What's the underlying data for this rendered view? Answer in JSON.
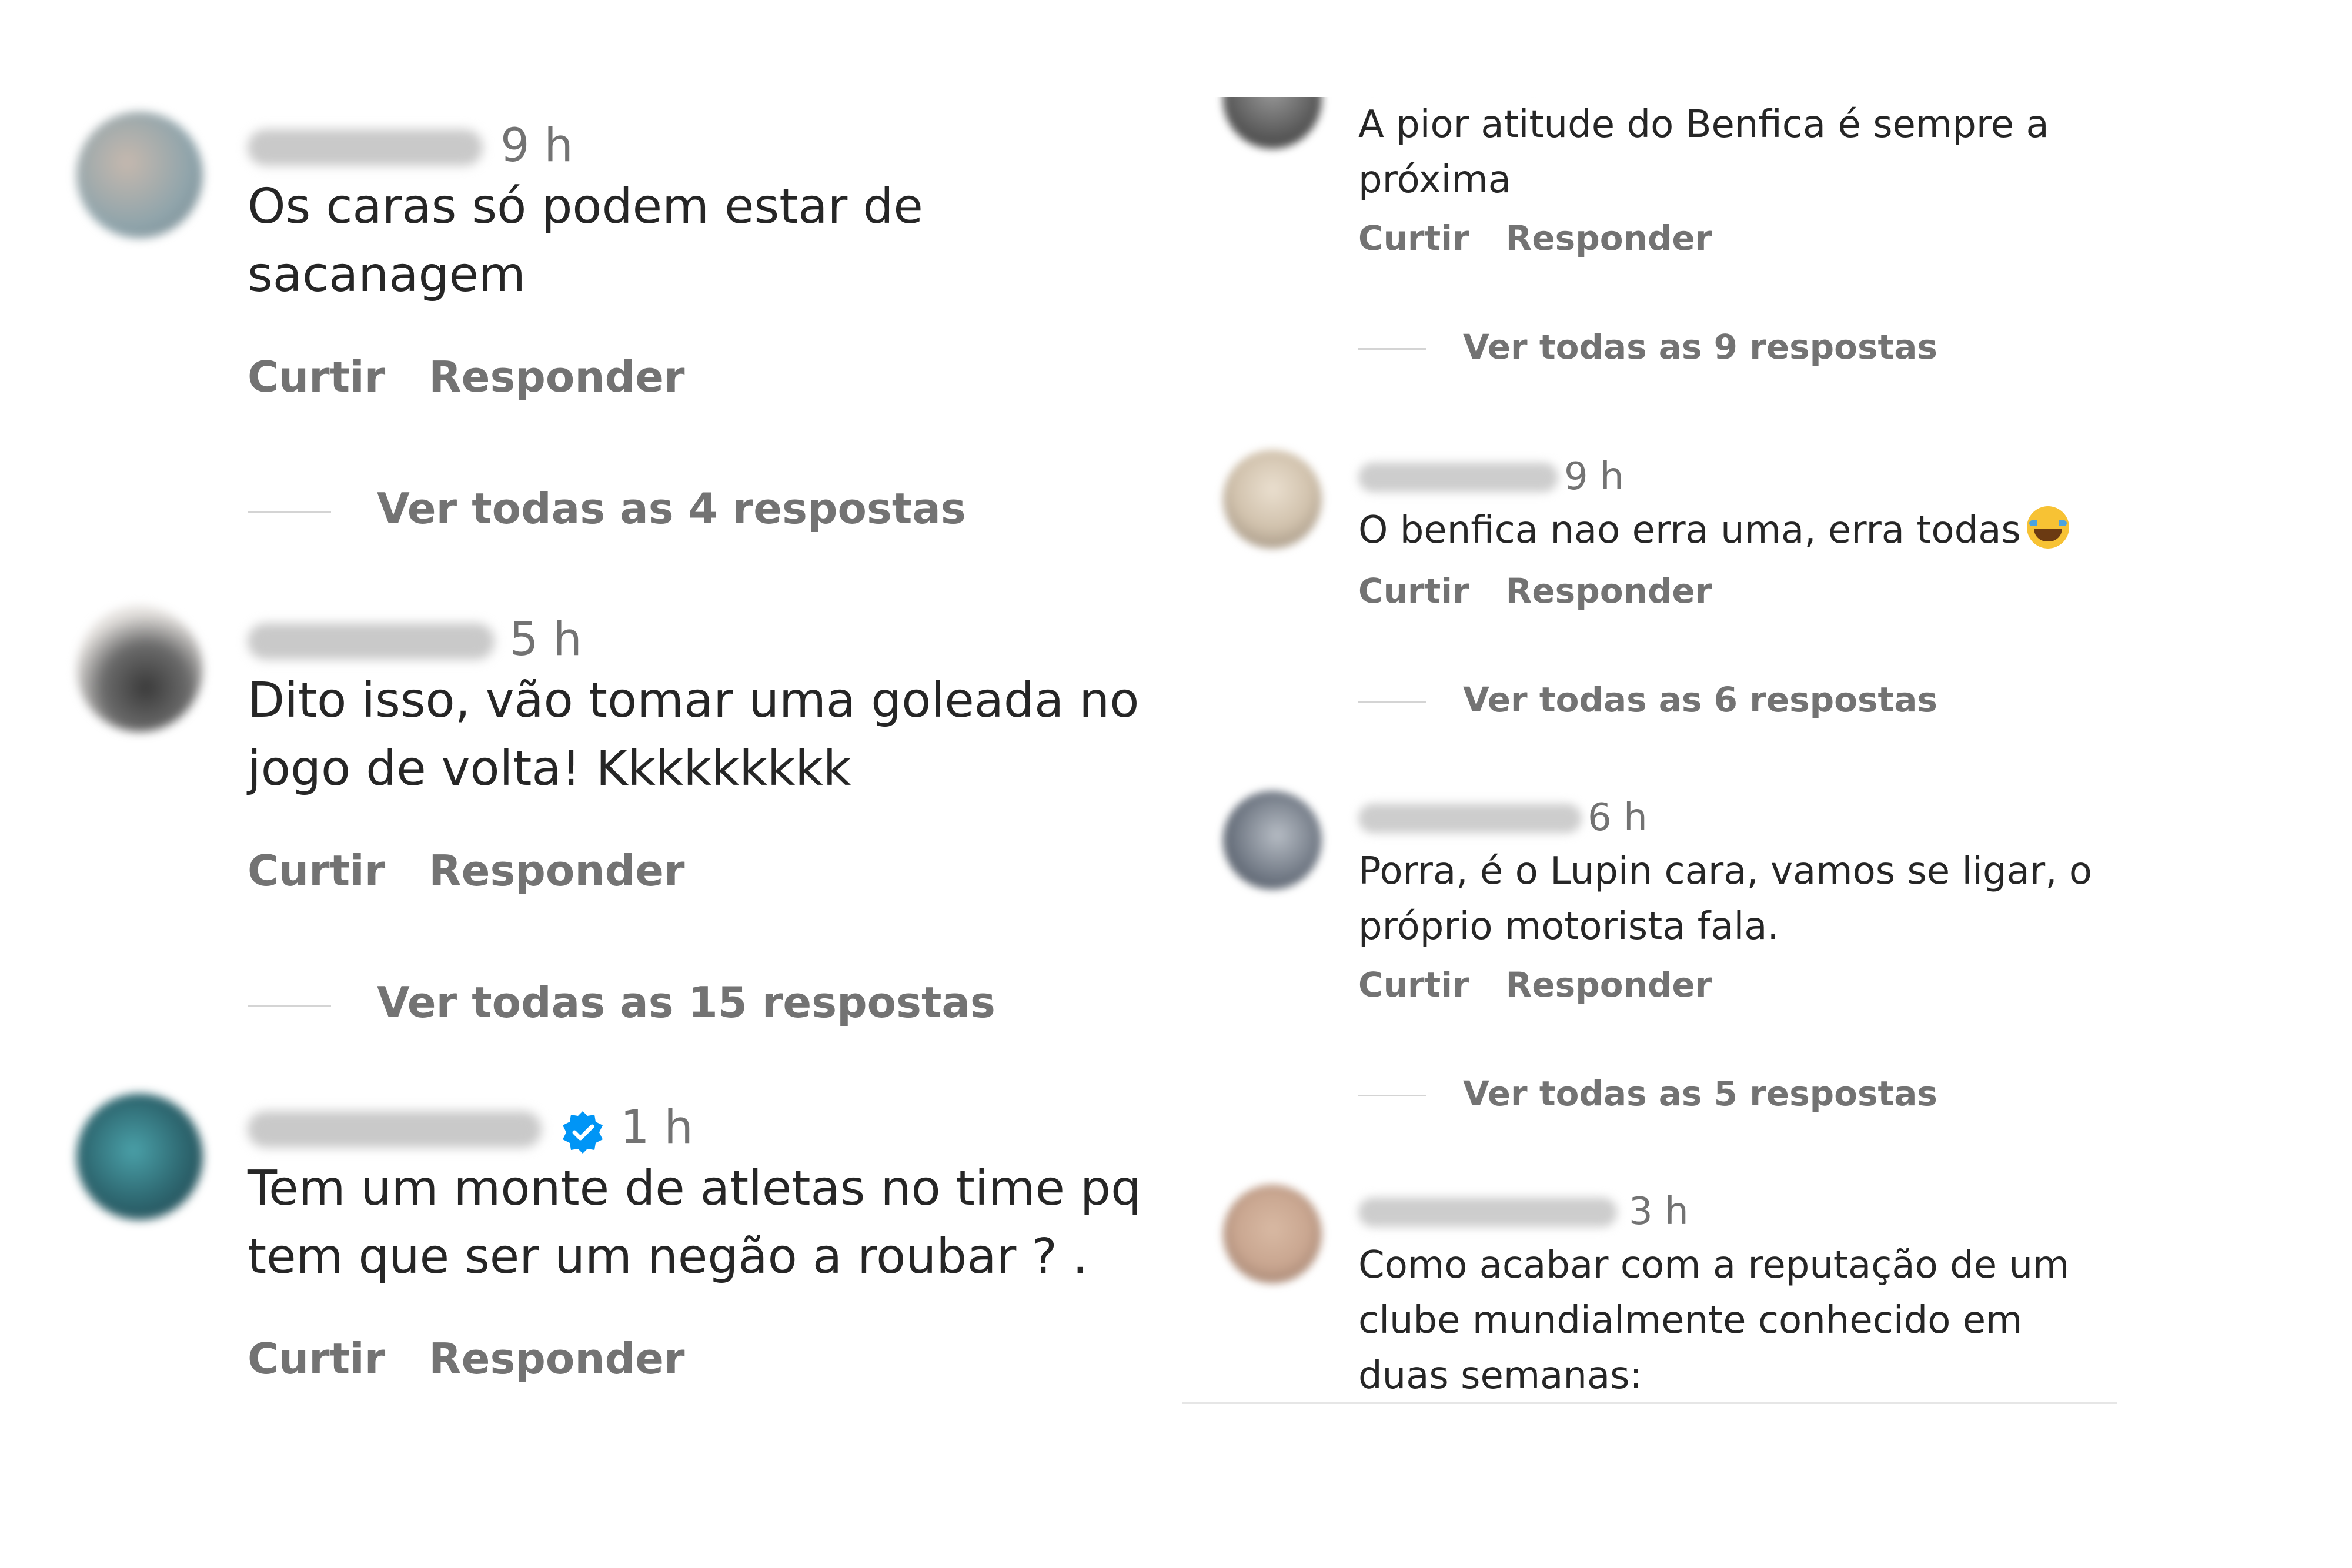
{
  "left_comments": [
    {
      "time": "9 h",
      "verified": false,
      "text": "Os caras só podem estar de sacanagem",
      "like_label": "Curtir",
      "reply_label": "Responder",
      "replies_label": "Ver todas as 4 respostas",
      "avatar_colors": [
        "#8fa4ab",
        "#c5b8ae"
      ]
    },
    {
      "time": "5 h",
      "verified": false,
      "text": "Dito isso, vão tomar uma goleada no jogo de volta! Kkkkkkkkk",
      "like_label": "Curtir",
      "reply_label": "Responder",
      "replies_label": "Ver todas as 15 respostas",
      "avatar_colors": [
        "#e6e3e0",
        "#4a4a4a"
      ]
    },
    {
      "time": "1 h",
      "verified": true,
      "text": "Tem um monte de atletas no time pq tem que ser um negão a roubar ? .",
      "like_label": "Curtir",
      "reply_label": "Responder",
      "replies_label": "",
      "avatar_colors": [
        "#3a8a93",
        "#1e3d47"
      ]
    }
  ],
  "right_comments": [
    {
      "time": "",
      "text": "A pior atitude do Benfica é sempre a próxima",
      "like_label": "Curtir",
      "reply_label": "Responder",
      "replies_label": "Ver todas as 9 respostas",
      "avatar_colors": [
        "#5a5a5a",
        "#9a9a9a"
      ]
    },
    {
      "time": "9 h",
      "text": "O benfica nao erra uma, erra todas",
      "emoji": "tears-of-joy-emoji",
      "like_label": "Curtir",
      "reply_label": "Responder",
      "replies_label": "Ver todas as 6 respostas",
      "avatar_colors": [
        "#d1c2ad",
        "#8d7f6f"
      ]
    },
    {
      "time": "6 h",
      "text": "Porra, é o Lupin cara, vamos se ligar, o próprio motorista fala.",
      "like_label": "Curtir",
      "reply_label": "Responder",
      "replies_label": "Ver todas as 5 respostas",
      "avatar_colors": [
        "#6c7480",
        "#b6bcc4"
      ]
    },
    {
      "time": "3 h",
      "text": "Como acabar com a reputação de um clube mundialmente conhecido em duas semanas:",
      "like_label": "",
      "reply_label": "",
      "replies_label": "",
      "avatar_colors": [
        "#c9a690",
        "#8c6e5f"
      ]
    }
  ],
  "colors": {
    "text": "#262626",
    "secondary": "#737373",
    "verified": "#0095f6",
    "divider": "#d4d4d4"
  }
}
